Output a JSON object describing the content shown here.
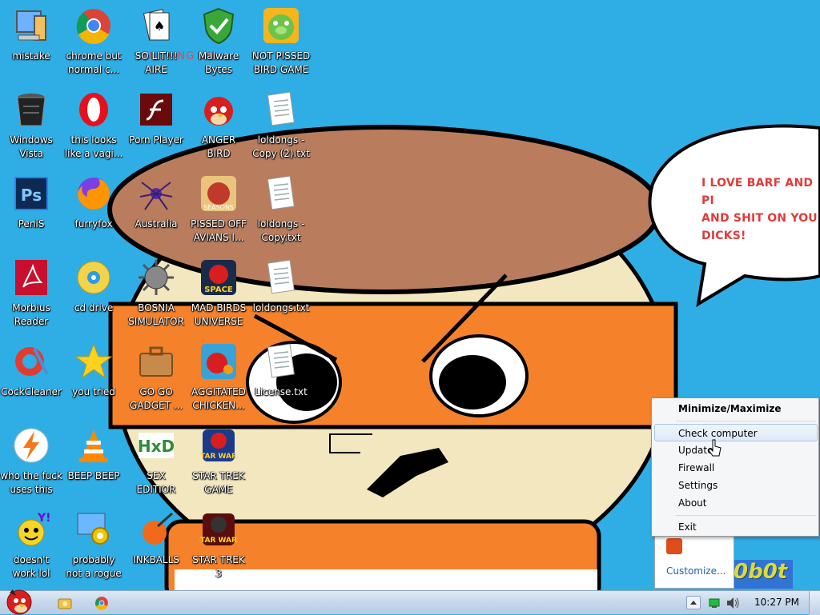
{
  "desktop": {
    "icons": [
      {
        "id": "mistake",
        "label": "mistake",
        "icon": "computer-icon"
      },
      {
        "id": "chrome",
        "label": "chrome but\nnormal c...",
        "icon": "chrome-icon"
      },
      {
        "id": "solitaire",
        "label": "SO LIT!!!\nAIRE",
        "icon": "solitaire-cards-icon"
      },
      {
        "id": "malwarebytes",
        "label": "Malware\nBytes",
        "icon": "shield-check-icon"
      },
      {
        "id": "pissed-bird",
        "label": "NOT PISSED\nBIRD GAME",
        "icon": "green-pig-icon"
      },
      {
        "id": "windows-vista",
        "label": "Windows\nVista",
        "icon": "trash-bin-icon"
      },
      {
        "id": "opera",
        "label": "this looks\nlike a vagi...",
        "icon": "opera-icon"
      },
      {
        "id": "flash",
        "label": "Porn Player",
        "icon": "flash-player-icon"
      },
      {
        "id": "anger-bird",
        "label": "ANGER\nBIRD",
        "icon": "angry-bird-icon"
      },
      {
        "id": "loldongs-copy2",
        "label": "loldongs -\nCopy (2).txt",
        "icon": "text-file-icon"
      },
      {
        "id": "photoshop",
        "label": "PeniS",
        "icon": "photoshop-icon"
      },
      {
        "id": "firefox",
        "label": "furryfox",
        "icon": "firefox-icon"
      },
      {
        "id": "australia",
        "label": "Australia",
        "icon": "spider-solitaire-icon"
      },
      {
        "id": "pissed-off-avians",
        "label": "PISSED OFF\nAVIANS I...",
        "icon": "angry-birds-seasons-icon"
      },
      {
        "id": "loldongs-copy",
        "label": "loldongs -\nCopy.txt",
        "icon": "text-file-icon"
      },
      {
        "id": "morbius",
        "label": "Morbius\nReader",
        "icon": "acrobat-reader-icon"
      },
      {
        "id": "cd-drive",
        "label": "cd drive",
        "icon": "cd-disc-icon"
      },
      {
        "id": "bosnia",
        "label": "BOSNIA\nSIMULATOR",
        "icon": "spiked-mine-icon"
      },
      {
        "id": "mad-birds",
        "label": "MAD BIRDS\nUNIVERSE",
        "icon": "angry-birds-space-icon"
      },
      {
        "id": "loldongs",
        "label": "loldongs.txt",
        "icon": "text-file-icon"
      },
      {
        "id": "cockcleaner",
        "label": "CockCleaner",
        "icon": "ccleaner-icon"
      },
      {
        "id": "you-tried",
        "label": "you tried",
        "icon": "star-icon"
      },
      {
        "id": "go-go-gadget",
        "label": "GO GO\nGADGET ...",
        "icon": "briefcase-icon"
      },
      {
        "id": "aggitated-chicken",
        "label": "AGGITATED\nCHICKEN...",
        "icon": "angry-birds-rio-icon"
      },
      {
        "id": "license",
        "label": "License.txt",
        "icon": "text-file-icon"
      },
      {
        "id": "who-uses-this",
        "label": "who the fuck\nuses this",
        "icon": "lightning-bolt-icon"
      },
      {
        "id": "beep-beep",
        "label": "BEEP BEEP",
        "icon": "vlc-cone-icon"
      },
      {
        "id": "sex-editior",
        "label": "SEX\nEDITIOR",
        "icon": "hxd-icon"
      },
      {
        "id": "star-trek-game",
        "label": "STAR TREK\nGAME",
        "icon": "star-wars-badge-icon"
      },
      {
        "id": "yahoo",
        "label": "doesn't\nwork lol",
        "icon": "yahoo-messenger-icon"
      },
      {
        "id": "rogue",
        "label": "probably\nnot a rogue",
        "icon": "gear-monitor-icon"
      },
      {
        "id": "inkballs",
        "label": "INKBALLS",
        "icon": "ink-ball-icon"
      },
      {
        "id": "star-trek-3",
        "label": "STAR TREK\n3",
        "icon": "star-wars-badge-icon"
      }
    ]
  },
  "wallpaper": {
    "overlay_text": "FUCKING VM",
    "bubble_text": "I LOVE BARF AND PI\nAND SHIT ON YOU\nDICKS!"
  },
  "context_menu": {
    "items": [
      {
        "label": "Minimize/Maximize",
        "bold": true
      },
      {
        "label": "Check computer",
        "hover": true
      },
      {
        "label": "Update"
      },
      {
        "label": "Firewall"
      },
      {
        "label": "Settings"
      },
      {
        "label": "About"
      },
      {
        "label": "Exit"
      }
    ]
  },
  "tray_overflow": {
    "customize_label": "Customize..."
  },
  "tray_logo_text": "0b0t",
  "taskbar": {
    "clock": "10:27 PM",
    "pinned": [
      {
        "icon": "angry-bird-start-icon"
      },
      {
        "icon": "folder-explorer-icon"
      },
      {
        "icon": "chrome-icon"
      }
    ],
    "tray": [
      "show-hidden-icons-arrow",
      "network-icon",
      "volume-icon"
    ]
  },
  "colors": {
    "desktop_bg": "#2faee6",
    "orange": "#f5822a",
    "brown_hat": "#b97d5e",
    "face": "#f3e7c0",
    "bubble_text": "#e23a3a"
  }
}
